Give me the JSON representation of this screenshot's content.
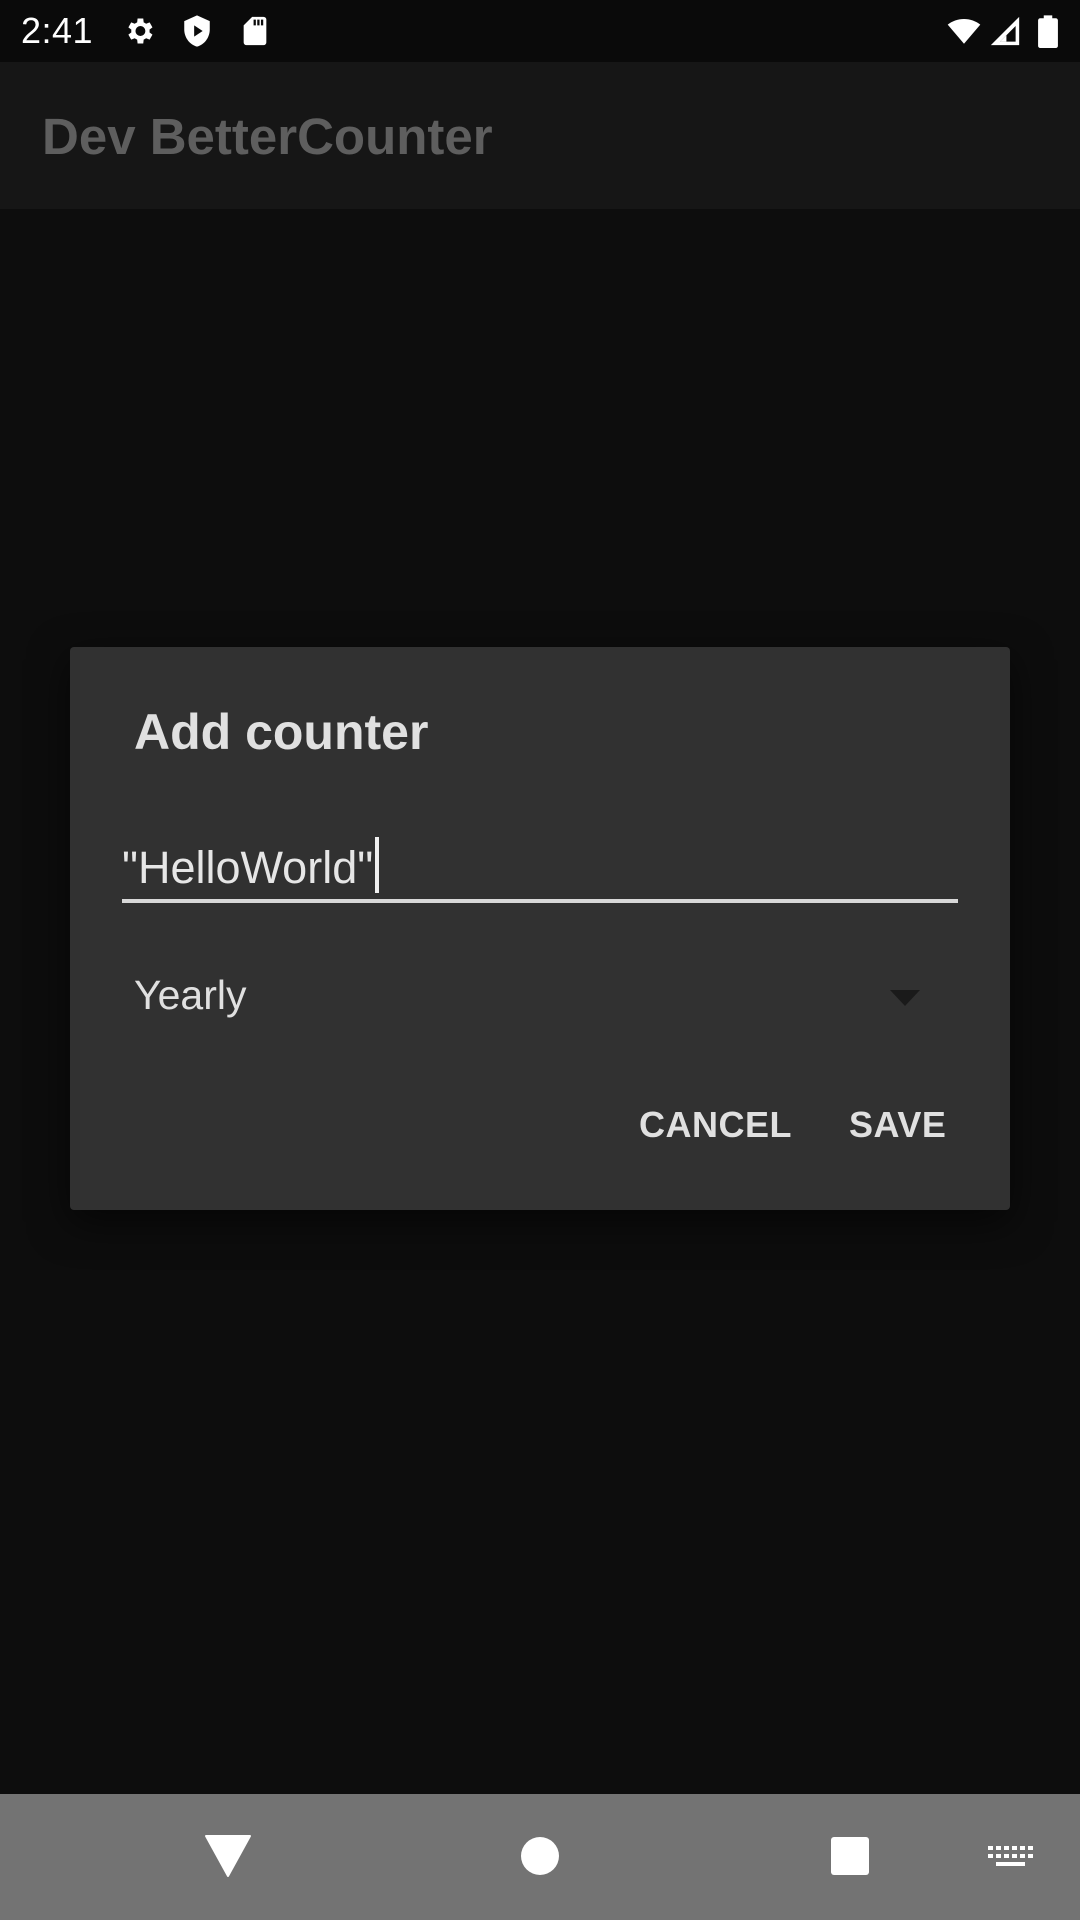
{
  "status_bar": {
    "time": "2:41",
    "icons": [
      "gear-icon",
      "shield-play-icon",
      "sd-card-icon",
      "wifi-icon",
      "cellular-signal-icon",
      "battery-icon"
    ]
  },
  "app_bar": {
    "title": "Dev BetterCounter"
  },
  "dialog": {
    "title": "Add counter",
    "name_value": "\"HelloWorld\"",
    "interval_selected": "Yearly",
    "cancel_label": "CANCEL",
    "save_label": "SAVE"
  },
  "nav_bar": {
    "icons": [
      "back-icon",
      "home-icon",
      "recents-icon",
      "keyboard-icon"
    ]
  },
  "colors": {
    "background": "#0d0d0d",
    "dialog": "#313131",
    "nav_bar": "#737373",
    "text_primary": "#e0e0e0",
    "app_title_dimmed": "#5e5e5e"
  }
}
